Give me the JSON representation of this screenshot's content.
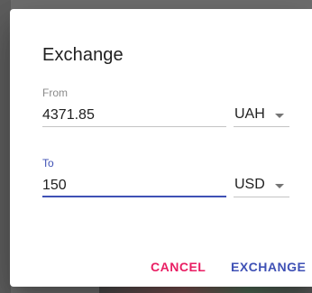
{
  "dialog": {
    "title": "Exchange",
    "from": {
      "label": "From",
      "amount": "4371.85",
      "currency": "UAH"
    },
    "to": {
      "label": "To",
      "amount": "150",
      "currency": "USD"
    },
    "actions": {
      "cancel_label": "CANCEL",
      "exchange_label": "EXCHANGE"
    }
  },
  "colors": {
    "primary": "#3f51b5",
    "accent": "#e91e63"
  },
  "icons": {
    "from_currency_caret": "chevron-down-icon",
    "to_currency_caret": "chevron-down-icon"
  }
}
